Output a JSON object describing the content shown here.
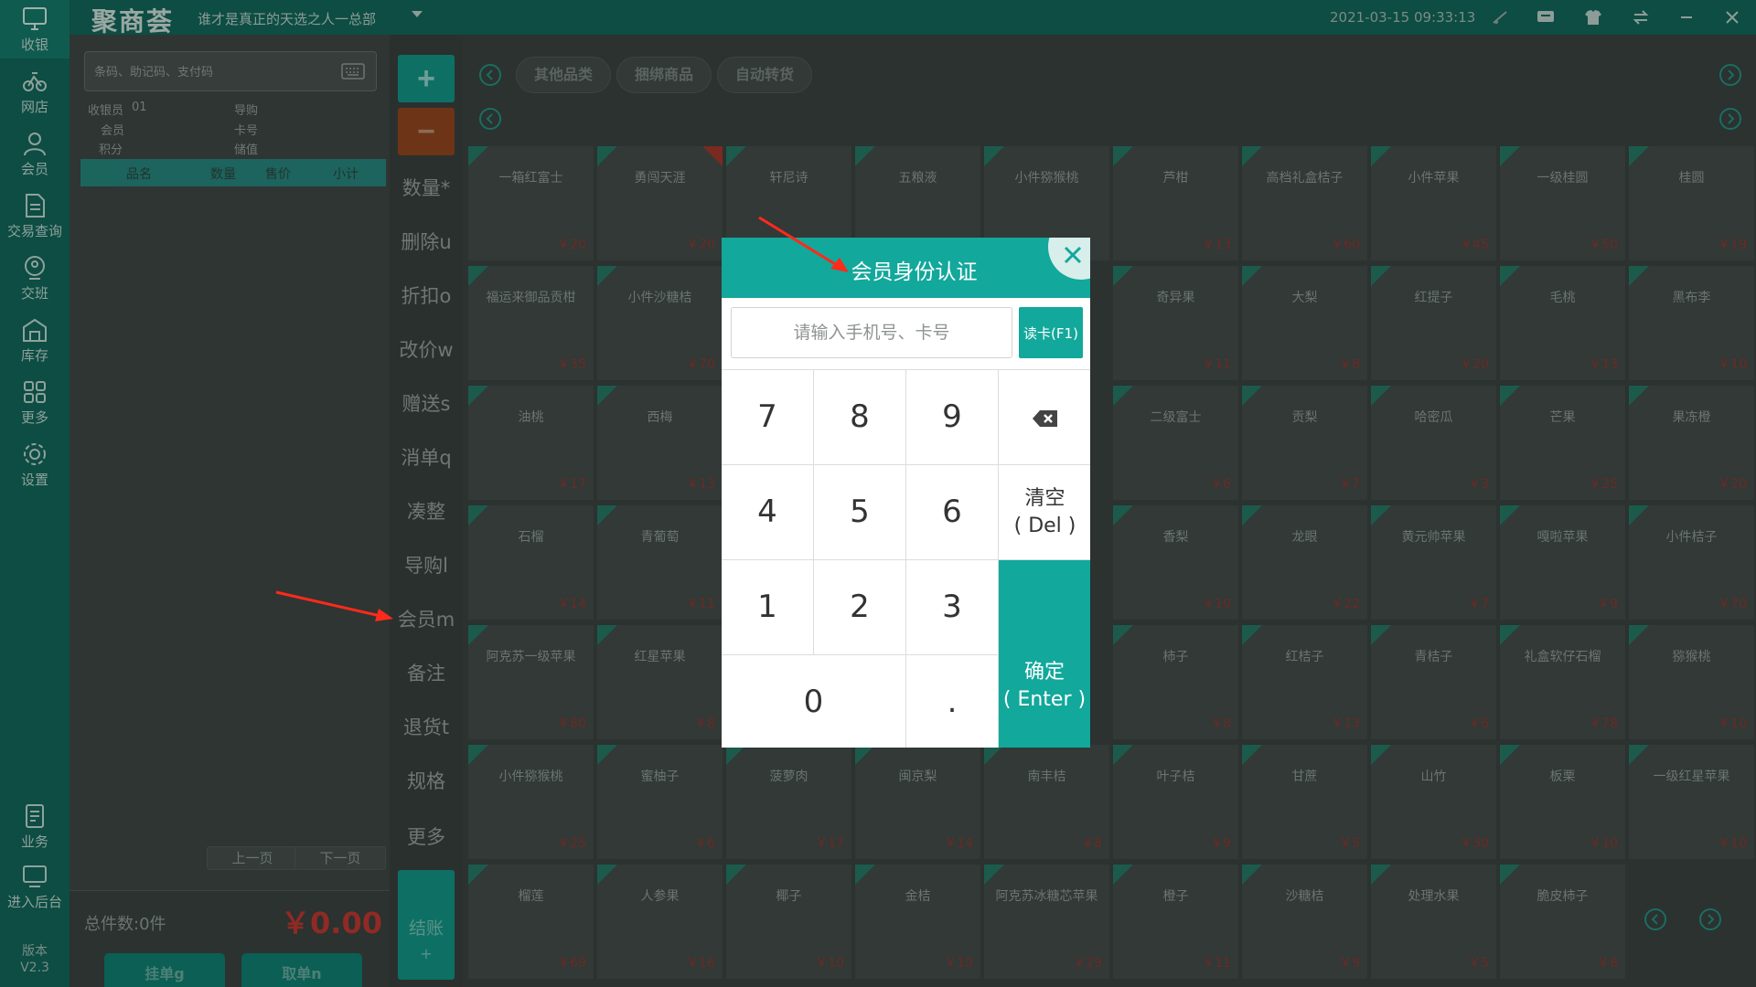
{
  "topbar": {
    "logo": "聚商荟",
    "store_name": "谁才是真正的天选之人一总部",
    "datetime": "2021-03-15 09:33:13"
  },
  "nav": {
    "items": [
      {
        "label": "收银",
        "icon": "monitor-icon"
      },
      {
        "label": "网店",
        "icon": "bike-icon"
      },
      {
        "label": "会员",
        "icon": "user-icon"
      },
      {
        "label": "交易查询",
        "icon": "document-icon"
      },
      {
        "label": "交班",
        "icon": "handover-icon"
      },
      {
        "label": "库存",
        "icon": "warehouse-icon"
      },
      {
        "label": "更多",
        "icon": "grid-icon"
      },
      {
        "label": "设置",
        "icon": "gear-icon"
      },
      {
        "label": "业务",
        "icon": "clipboard-icon"
      },
      {
        "label": "进入后台",
        "icon": "screen-icon"
      }
    ],
    "version_label": "版本",
    "version": "V2.3"
  },
  "cart": {
    "search_placeholder": "条码、助记码、支付码",
    "cashier_label": "收银员",
    "cashier_value": "01",
    "guide_label": "导购",
    "member_label": "会员",
    "card_label": "卡号",
    "points_label": "积分",
    "balance_label": "储值",
    "columns": [
      "品名",
      "数量",
      "售价",
      "小计"
    ],
    "prev_page": "上一页",
    "next_page": "下一页",
    "total_count": "总件数:0件",
    "total_amount": "￥0.00",
    "hold_button": "挂单g",
    "retrieve_button": "取单n"
  },
  "actions": {
    "plus": "+",
    "minus": "−",
    "buttons": [
      "数量*",
      "删除u",
      "折扣o",
      "改价w",
      "赠送s",
      "消单q",
      "凑整",
      "导购l",
      "会员m",
      "备注",
      "退货t",
      "规格",
      "更多"
    ],
    "checkout": "结账",
    "checkout_plus": "+"
  },
  "categories": [
    "其他品类",
    "捆绑商品",
    "自动转货"
  ],
  "products": [
    [
      {
        "n": "一箱红富士",
        "p": "￥20"
      },
      {
        "n": "勇闯天涯",
        "p": "￥20"
      },
      {
        "n": "轩尼诗",
        "p": ""
      },
      {
        "n": "五粮液",
        "p": ""
      },
      {
        "n": "小件猕猴桃",
        "p": ""
      },
      {
        "n": "芦柑",
        "p": "￥13"
      },
      {
        "n": "高档礼盒桔子",
        "p": "￥60"
      },
      {
        "n": "小件苹果",
        "p": "￥45"
      },
      {
        "n": "一级桂圆",
        "p": "￥50"
      },
      {
        "n": "桂圆",
        "p": "￥19"
      }
    ],
    [
      {
        "n": "福运来御品贡柑",
        "p": "￥35"
      },
      {
        "n": "小件沙糖桔",
        "p": "￥70"
      },
      {
        "n": "",
        "p": ""
      },
      {
        "n": "",
        "p": ""
      },
      {
        "n": "",
        "p": ""
      },
      {
        "n": "奇异果",
        "p": "￥11"
      },
      {
        "n": "大梨",
        "p": "￥8"
      },
      {
        "n": "红提子",
        "p": "￥20"
      },
      {
        "n": "毛桃",
        "p": "￥13"
      },
      {
        "n": "黑布李",
        "p": "￥10"
      }
    ],
    [
      {
        "n": "油桃",
        "p": "￥17"
      },
      {
        "n": "西梅",
        "p": "￥13"
      },
      {
        "n": "",
        "p": ""
      },
      {
        "n": "",
        "p": ""
      },
      {
        "n": "",
        "p": ""
      },
      {
        "n": "二级富士",
        "p": "￥6"
      },
      {
        "n": "贡梨",
        "p": "￥7"
      },
      {
        "n": "哈密瓜",
        "p": "￥3"
      },
      {
        "n": "芒果",
        "p": "￥25"
      },
      {
        "n": "果冻橙",
        "p": "￥20"
      }
    ],
    [
      {
        "n": "石榴",
        "p": "￥14"
      },
      {
        "n": "青葡萄",
        "p": "￥11"
      },
      {
        "n": "",
        "p": ""
      },
      {
        "n": "",
        "p": ""
      },
      {
        "n": "",
        "p": ""
      },
      {
        "n": "香梨",
        "p": "￥10"
      },
      {
        "n": "龙眼",
        "p": "￥22"
      },
      {
        "n": "黄元帅苹果",
        "p": "￥7"
      },
      {
        "n": "嘎啦苹果",
        "p": "￥9"
      },
      {
        "n": "小件桔子",
        "p": "￥70"
      }
    ],
    [
      {
        "n": "阿克苏一级苹果",
        "p": "￥80"
      },
      {
        "n": "红星苹果",
        "p": "￥8"
      },
      {
        "n": "",
        "p": ""
      },
      {
        "n": "",
        "p": ""
      },
      {
        "n": "",
        "p": ""
      },
      {
        "n": "柿子",
        "p": "￥8"
      },
      {
        "n": "红桔子",
        "p": "￥13"
      },
      {
        "n": "青桔子",
        "p": "￥6"
      },
      {
        "n": "礼盒软仔石榴",
        "p": "￥78"
      },
      {
        "n": "猕猴桃",
        "p": "￥10"
      }
    ],
    [
      {
        "n": "小件猕猴桃",
        "p": "￥25"
      },
      {
        "n": "蜜柚子",
        "p": "￥6"
      },
      {
        "n": "菠萝肉",
        "p": "￥17"
      },
      {
        "n": "闽京梨",
        "p": "￥14"
      },
      {
        "n": "南丰桔",
        "p": "￥8"
      },
      {
        "n": "叶子桔",
        "p": "￥9"
      },
      {
        "n": "甘蔗",
        "p": "￥5"
      },
      {
        "n": "山竹",
        "p": "￥30"
      },
      {
        "n": "板栗",
        "p": "￥10"
      },
      {
        "n": "一级红星苹果",
        "p": "￥10"
      }
    ],
    [
      {
        "n": "榴莲",
        "p": "￥69"
      },
      {
        "n": "人参果",
        "p": "￥16"
      },
      {
        "n": "椰子",
        "p": "￥10"
      },
      {
        "n": "金桔",
        "p": "￥10"
      },
      {
        "n": "阿克苏冰糖芯苹果",
        "p": "￥29"
      },
      {
        "n": "橙子",
        "p": "￥11"
      },
      {
        "n": "沙糖桔",
        "p": "￥9"
      },
      {
        "n": "处理水果",
        "p": "￥5"
      },
      {
        "n": "脆皮柿子",
        "p": "￥8"
      }
    ]
  ],
  "modal": {
    "title": "会员身份认证",
    "input_placeholder": "请输入手机号、卡号",
    "read_card": "读卡(F1)",
    "keys": {
      "k7": "7",
      "k8": "8",
      "k9": "9",
      "k4": "4",
      "k5": "5",
      "k6": "6",
      "k1": "1",
      "k2": "2",
      "k3": "3",
      "k0": "0",
      "kdot": "."
    },
    "clear_label": "清空",
    "clear_hint": "( Del )",
    "enter_label": "确定",
    "enter_hint": "( Enter )"
  }
}
